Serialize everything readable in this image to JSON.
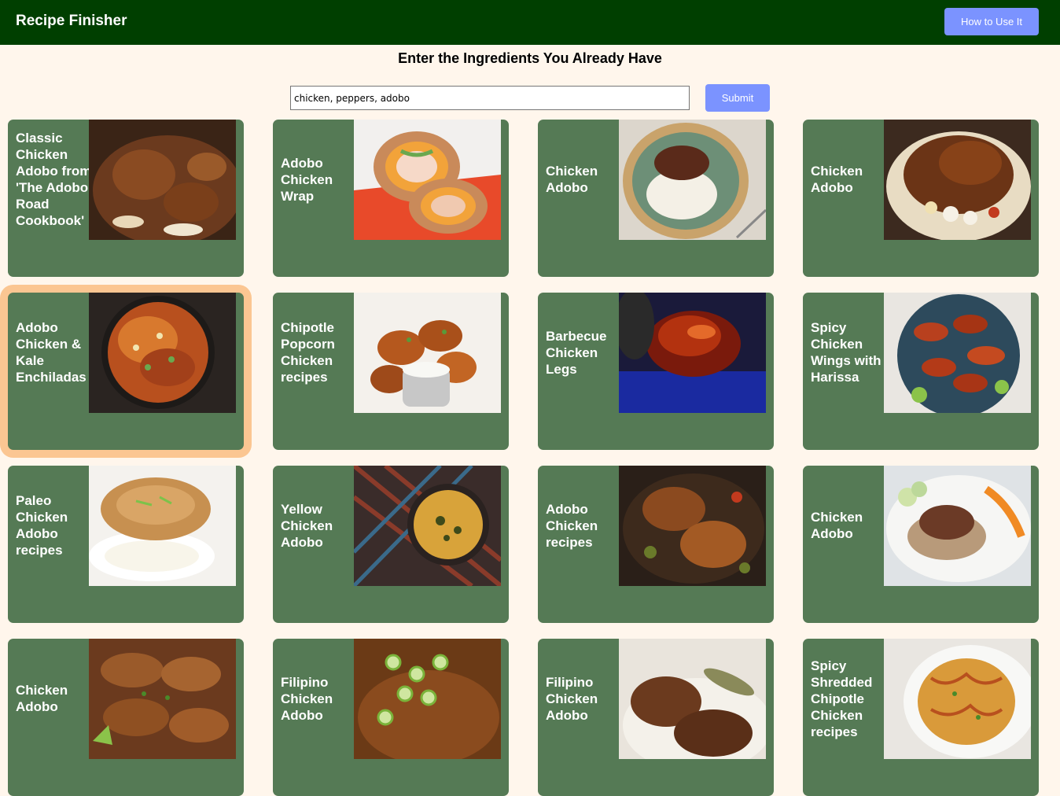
{
  "header": {
    "title": "Recipe Finisher",
    "help_label": "How to Use It",
    "accent": "#7b93ff",
    "bar_color": "#003f00"
  },
  "search": {
    "heading": "Enter the Ingredients You Already Have",
    "value": "chicken, peppers, adobo",
    "submit_label": "Submit"
  },
  "recipes": [
    {
      "title": "Classic Chicken Adobo from 'The Adobo Road Cookbook'",
      "photo": "braised-chicken-bowl",
      "selected": false
    },
    {
      "title": "Adobo Chicken Wrap",
      "photo": "tortilla-wrap",
      "selected": false
    },
    {
      "title": "Chicken Adobo",
      "photo": "chicken-on-rice-plate",
      "selected": false
    },
    {
      "title": "Chicken Adobo",
      "photo": "roast-chicken-garlic",
      "selected": false
    },
    {
      "title": "Adobo Chicken & Kale Enchiladas",
      "photo": "enchilada-skillet",
      "selected": true
    },
    {
      "title": "Chipotle Popcorn Chicken recipes",
      "photo": "fried-chicken-dip",
      "selected": false
    },
    {
      "title": "Barbecue Chicken Legs",
      "photo": "glazed-chicken",
      "selected": false
    },
    {
      "title": "Spicy Chicken Wings with Harissa",
      "photo": "wings-platter",
      "selected": false
    },
    {
      "title": "Paleo Chicken Adobo recipes",
      "photo": "chicken-and-rice",
      "selected": false
    },
    {
      "title": "Yellow Chicken Adobo",
      "photo": "yellow-curry-bowl",
      "selected": false
    },
    {
      "title": "Adobo Chicken recipes",
      "photo": "roasted-chicken-pan",
      "selected": false
    },
    {
      "title": "Chicken Adobo",
      "photo": "chicken-salad-plate",
      "selected": false
    },
    {
      "title": "Chicken Adobo",
      "photo": "braised-drumsticks",
      "selected": false
    },
    {
      "title": "Filipino Chicken Adobo",
      "photo": "scallion-chicken",
      "selected": false
    },
    {
      "title": "Filipino Chicken Adobo",
      "photo": "bay-leaf-chicken",
      "selected": false
    },
    {
      "title": "Spicy Shredded Chipotle Chicken recipes",
      "photo": "shredded-chicken-pasta",
      "selected": false
    }
  ]
}
